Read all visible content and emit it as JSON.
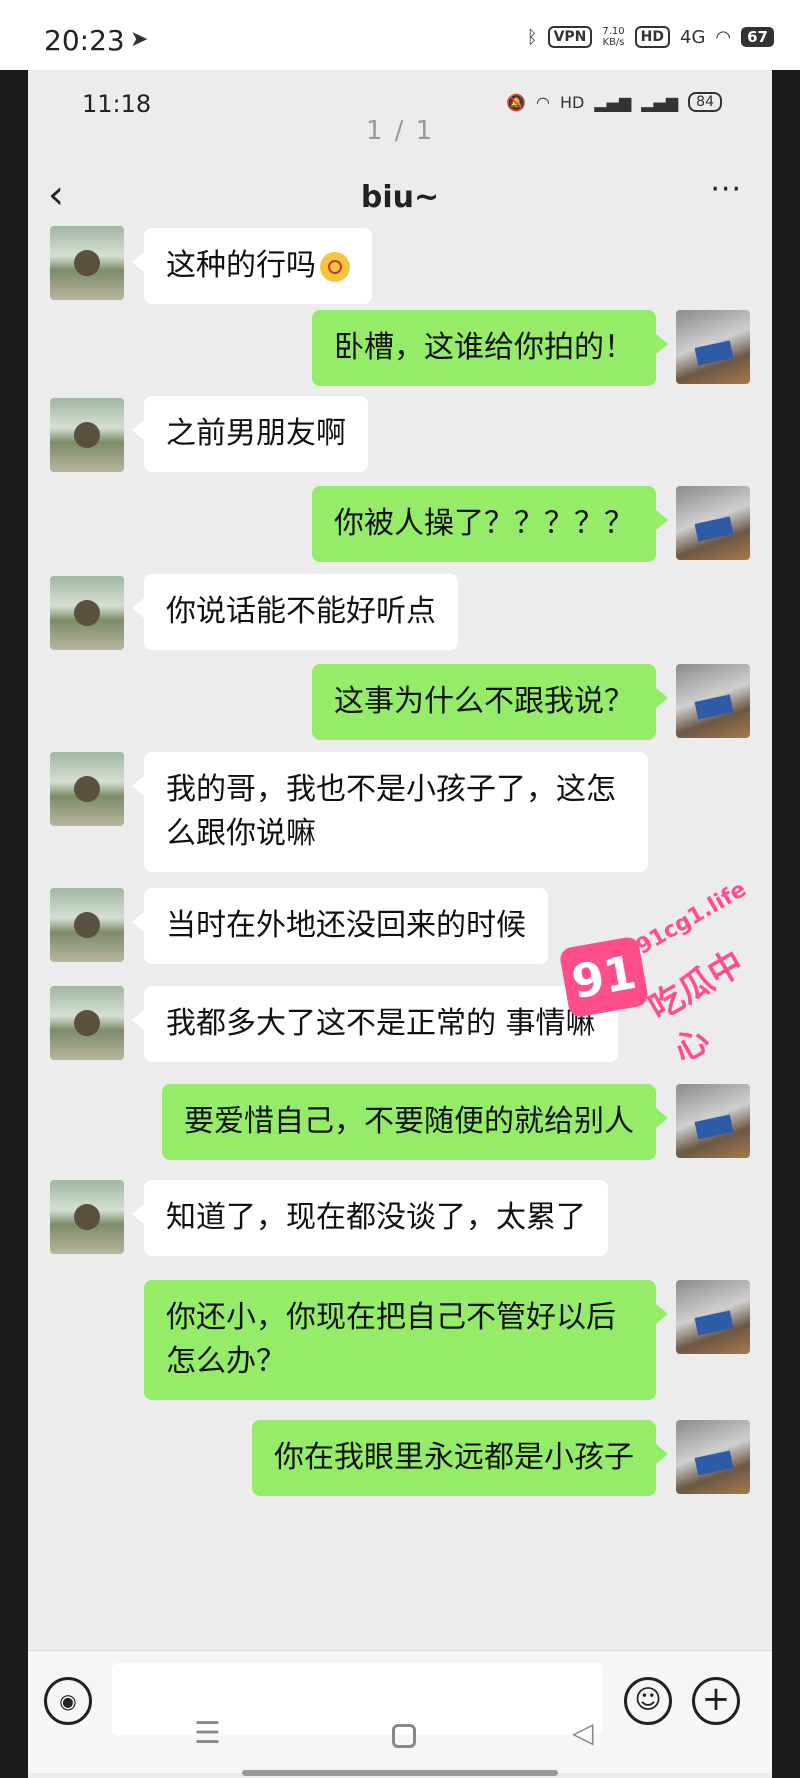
{
  "device_status": {
    "time": "20:23",
    "vpn": "VPN",
    "speed": "7.10\nKB/s",
    "hd": "HD",
    "signal": "4G",
    "battery": "67"
  },
  "screenshot_status": {
    "time": "11:18",
    "battery": "84"
  },
  "page_indicator": "1 / 1",
  "header": {
    "back_icon": "‹",
    "title": "biu~",
    "more_icon": "···"
  },
  "messages": [
    {
      "side": "left",
      "text": "这种的行吗",
      "emoji": true
    },
    {
      "side": "right",
      "text": "卧槽，这谁给你拍的！"
    },
    {
      "side": "left",
      "text": "之前男朋友啊"
    },
    {
      "side": "right",
      "text": "你被人操了？？？？？"
    },
    {
      "side": "left",
      "text": "你说话能不能好听点"
    },
    {
      "side": "right",
      "text": "这事为什么不跟我说？"
    },
    {
      "side": "left",
      "text": "我的哥，我也不是小孩子了，这怎么跟你说嘛"
    },
    {
      "side": "left",
      "text": "当时在外地还没回来的时候"
    },
    {
      "side": "left",
      "text": "我都多大了这不是正常的 事情嘛"
    },
    {
      "side": "right",
      "text": "要爱惜自己，不要随便的就给别人"
    },
    {
      "side": "left",
      "text": "知道了，现在都没谈了，太累了"
    },
    {
      "side": "right",
      "text": "你还小，你现在把自己不管好以后怎么办？"
    },
    {
      "side": "right",
      "text": "你在我眼里永远都是小孩子"
    }
  ],
  "watermark": {
    "badge": "91",
    "site": "91cg1.life",
    "text": "吃瓜中心"
  },
  "input_bar": {
    "voice_icon": "◉",
    "emoji_icon": "☺",
    "plus_icon": "+"
  },
  "nav": {
    "menu_icon": "☰",
    "back_icon": "◁"
  },
  "colors": {
    "own_bubble": "#95ec69",
    "other_bubble": "#ffffff",
    "background": "#ececec",
    "watermark": "#ff4f8b"
  }
}
